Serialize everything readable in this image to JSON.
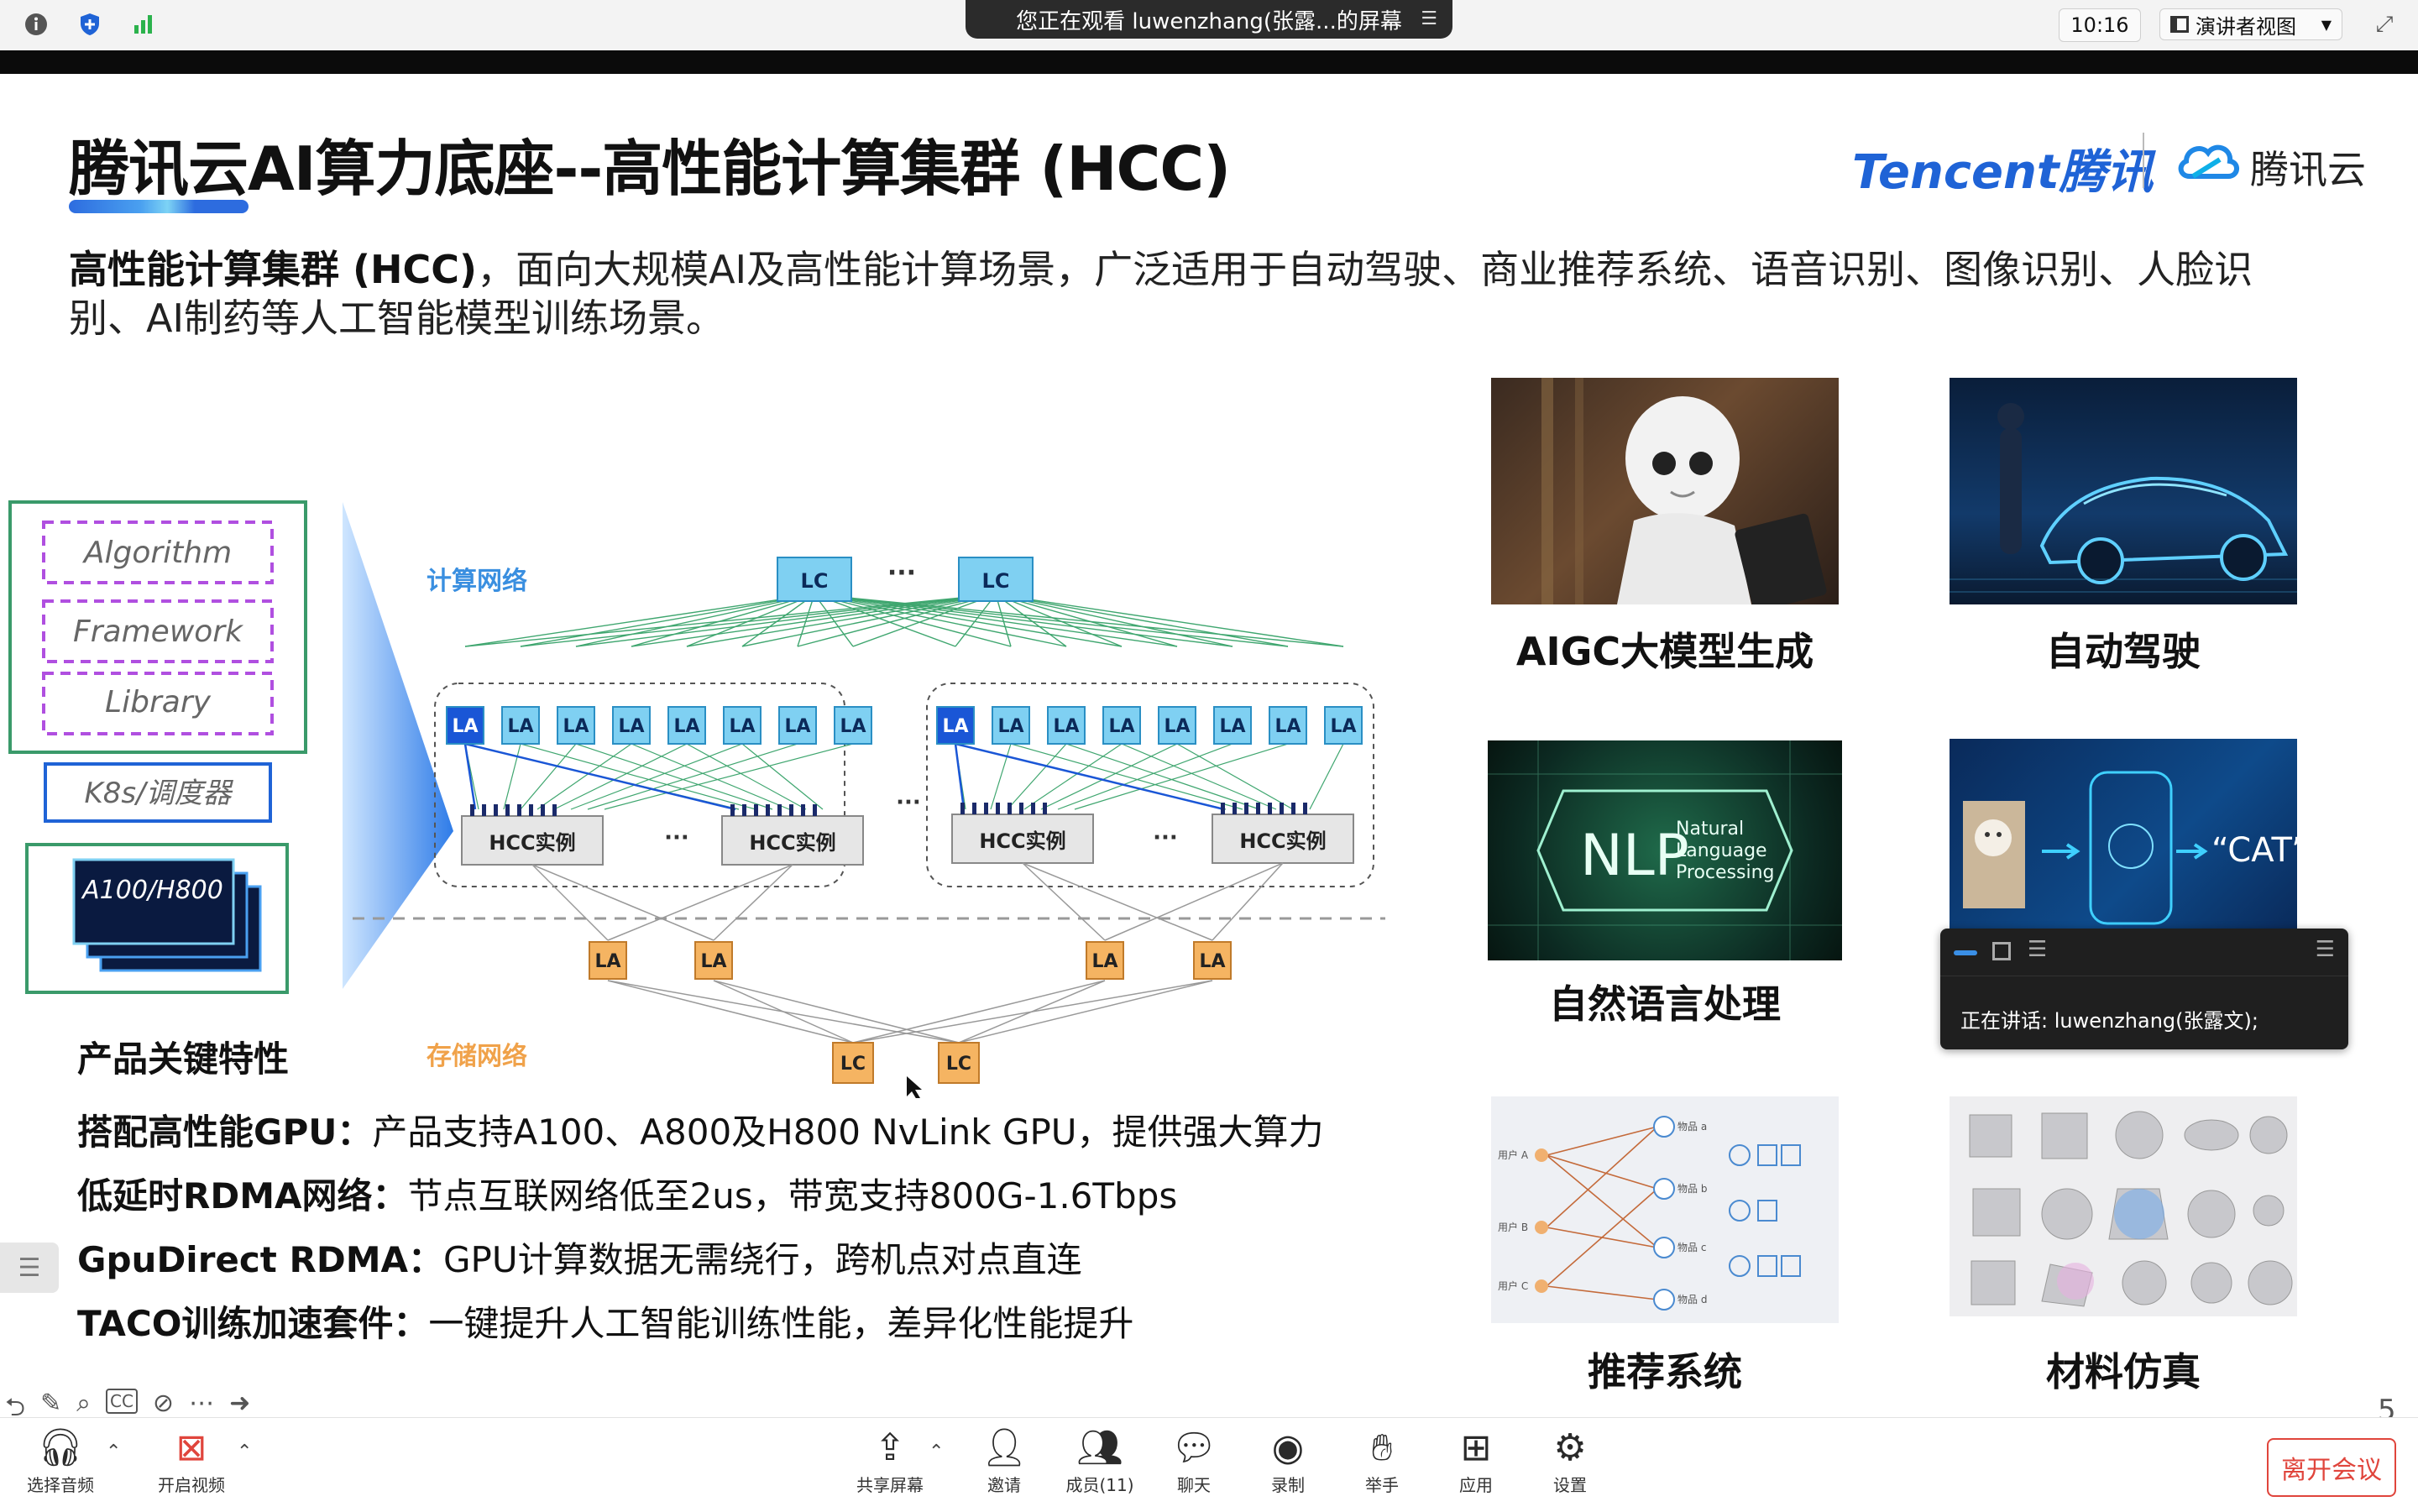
{
  "topbar": {
    "share_text": "您正在观看 luwenzhang(张露...的屏幕",
    "time": "10:16",
    "view_label": "演讲者视图"
  },
  "slide": {
    "title": "腾讯云AI算力底座--高性能计算集群 (HCC)",
    "logo_tencent": "Tencent腾讯",
    "logo_cloud": "腾讯云",
    "intro_bold": "高性能计算集群 (HCC)",
    "intro_rest": "，面向大规模AI及高性能计算场景，广泛适用于自动驾驶、商业推荐系统、语音识别、图像识别、人脸识别、AI制药等人工智能模型训练场景。",
    "stack": [
      "Algorithm",
      "Framework",
      "Library"
    ],
    "scheduler": "K8s/调度器",
    "gpu": "A100/H800",
    "compute_net": "计算网络",
    "storage_net": "存储网络",
    "lc": "LC",
    "la": "LA",
    "hcc": "HCC实例",
    "ellipsis": "···",
    "features_head": "产品关键特性",
    "features": [
      {
        "bold": "搭配高性能GPU：",
        "text": "产品支持A100、A800及H800 NvLink GPU，提供强大算力"
      },
      {
        "bold": "低延时RDMA网络：",
        "text": "节点互联网络低至2us，带宽支持800G-1.6Tbps"
      },
      {
        "bold": "GpuDirect RDMA：",
        "text": "GPU计算数据无需绕行，跨机点对点直连"
      },
      {
        "bold": "TACO训练加速套件：",
        "text": "一键提升人工智能训练性能，差异化性能提升"
      }
    ],
    "captions": [
      "AIGC大模型生成",
      "自动驾驶",
      "自然语言处理",
      "推荐系统",
      "材料仿真"
    ],
    "nlp_big": "NLP",
    "nlp_small": [
      "Natural",
      "Language",
      "Processing"
    ],
    "cat_label": "“CAT”",
    "rec_users": [
      "用户 A",
      "用户 B",
      "用户 C"
    ],
    "rec_items": [
      "物品 a",
      "物品 b",
      "物品 c",
      "物品 d"
    ],
    "page_number": "5"
  },
  "speaker_panel": {
    "text": "正在讲话: luwenzhang(张露文);"
  },
  "bottombar": {
    "items": [
      "选择音频",
      "开启视频",
      "共享屏幕",
      "邀请",
      "成员(11)",
      "聊天",
      "录制",
      "举手",
      "应用",
      "设置"
    ],
    "leave": "离开会议"
  },
  "colors": {
    "accent_blue": "#1f63d6",
    "la_blue": "#7fd0f2",
    "la_dark": "#1a56d6",
    "la_orange": "#f5b462",
    "stack_purple": "#b04fe0",
    "stack_green": "#3a9a6a",
    "leave_red": "#e0453c"
  }
}
